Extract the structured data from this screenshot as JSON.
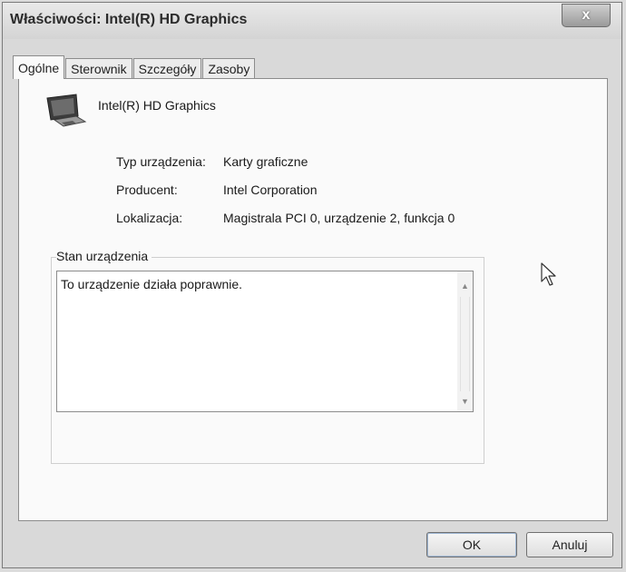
{
  "window": {
    "title": "Właściwości: Intel(R) HD Graphics",
    "close_label": "x"
  },
  "tabs": [
    {
      "label": "Ogólne",
      "active": true
    },
    {
      "label": "Sterownik",
      "active": false
    },
    {
      "label": "Szczegóły",
      "active": false
    },
    {
      "label": "Zasoby",
      "active": false
    }
  ],
  "device": {
    "icon": "monitor-icon",
    "name": "Intel(R) HD Graphics"
  },
  "properties": [
    {
      "label": "Typ urządzenia:",
      "value": "Karty graficzne"
    },
    {
      "label": "Producent:",
      "value": "Intel Corporation"
    },
    {
      "label": "Lokalizacja:",
      "value": "Magistrala PCI 0, urządzenie 2, funkcja 0"
    }
  ],
  "status": {
    "group_label": "Stan urządzenia",
    "text": "To urządzenie działa poprawnie."
  },
  "buttons": {
    "ok": "OK",
    "cancel": "Anuluj"
  }
}
